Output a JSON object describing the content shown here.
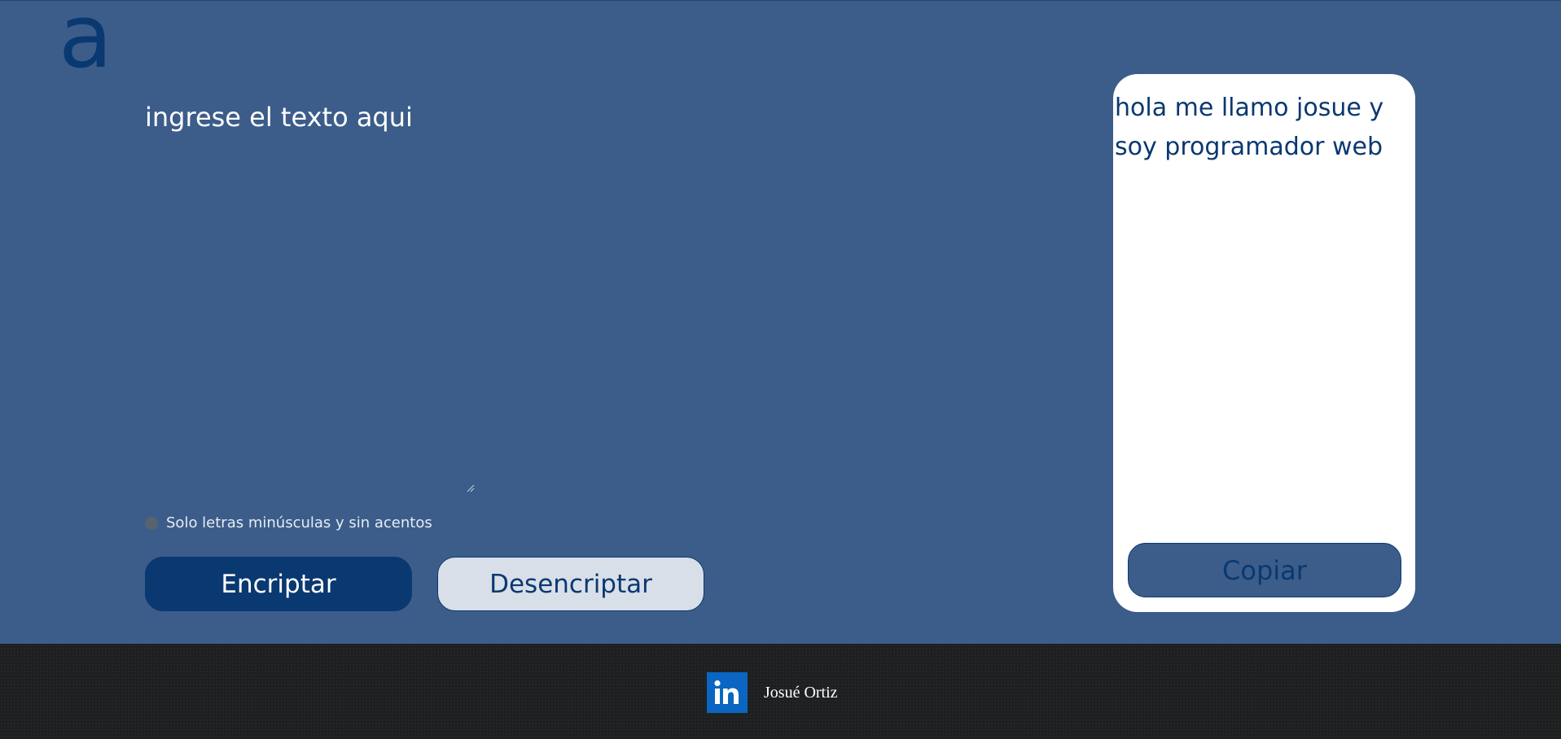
{
  "header": {
    "logo_text": "a"
  },
  "input": {
    "placeholder": "ingrese el texto aqui",
    "value": ""
  },
  "hint": {
    "text": "Solo letras minúsculas y sin acentos"
  },
  "buttons": {
    "encrypt_label": "Encriptar",
    "decrypt_label": "Desencriptar",
    "copy_label": "Copiar"
  },
  "output": {
    "text": "hola me llamo josue y soy programador web"
  },
  "footer": {
    "icon": "linkedin-icon",
    "author_name": "Josué Ortiz"
  },
  "colors": {
    "background": "#3c5d8a",
    "primary": "#0a3871",
    "secondary_button": "#d8dfe8",
    "card": "#ffffff",
    "footer": "#1d1f21",
    "linkedin": "#0a66c2"
  }
}
